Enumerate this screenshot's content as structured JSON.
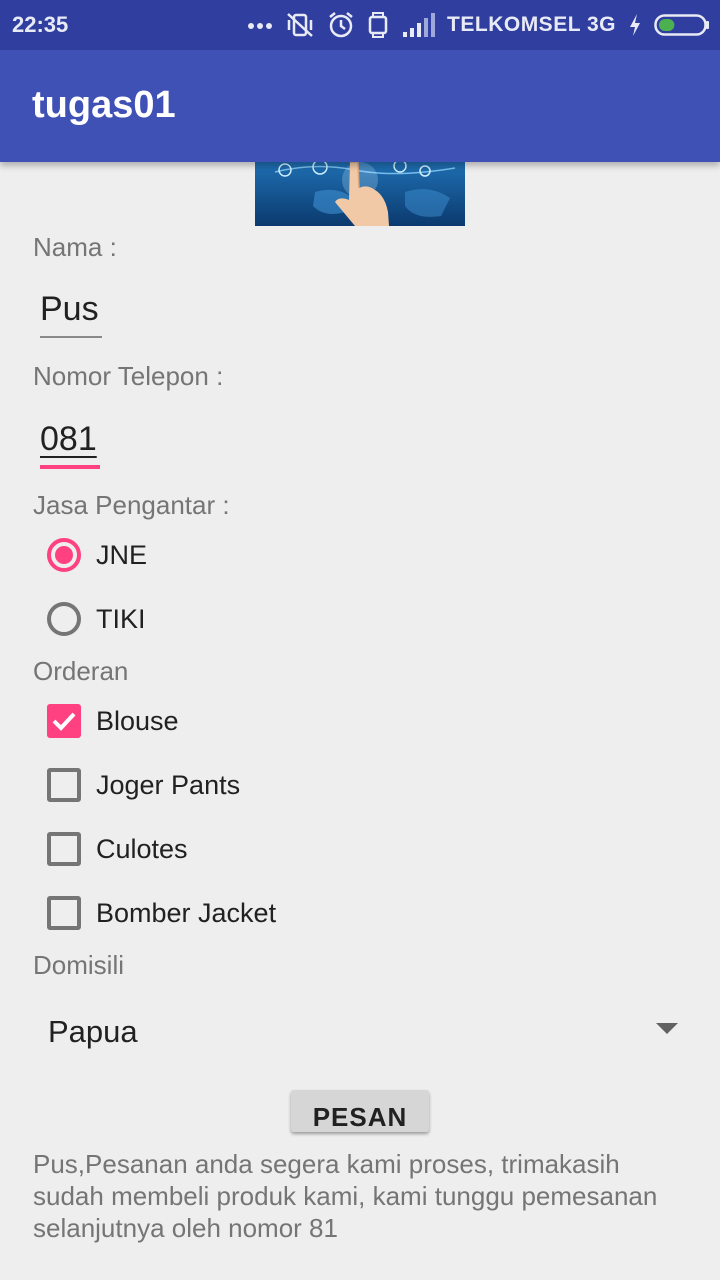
{
  "status_bar": {
    "time": "22:35",
    "carrier": "TELKOMSEL 3G",
    "icons": [
      "more-dots-icon",
      "vibrate-off-icon",
      "alarm-icon",
      "watch-icon",
      "signal-icon",
      "charging-icon",
      "battery-icon"
    ],
    "battery_level": 0.35
  },
  "app_bar": {
    "title": "tugas01"
  },
  "banner": {
    "icon": "touch-network-image"
  },
  "form": {
    "name_label": "Nama :",
    "name_value": "Pus",
    "phone_label": "Nomor Telepon :",
    "phone_value": "081",
    "courier_label": "Jasa Pengantar :",
    "couriers": [
      {
        "label": "JNE",
        "selected": true
      },
      {
        "label": "TIKI",
        "selected": false
      }
    ],
    "order_label": "Orderan",
    "orders": [
      {
        "label": "Blouse",
        "checked": true
      },
      {
        "label": "Joger Pants",
        "checked": false
      },
      {
        "label": "Culotes",
        "checked": false
      },
      {
        "label": "Bomber Jacket",
        "checked": false
      }
    ],
    "domicile_label": "Domisili",
    "domicile_value": "Papua",
    "submit_label": "PESAN",
    "result_text": "Pus,Pesanan anda segera kami proses, trimakasih sudah membeli produk kami, kami tunggu pemesanan selanjutnya oleh nomor 81"
  },
  "colors": {
    "status_bar": "#303f9f",
    "app_bar": "#3f51b5",
    "accent": "#ff4081",
    "background": "#eeeeee",
    "label_text": "#757575"
  }
}
